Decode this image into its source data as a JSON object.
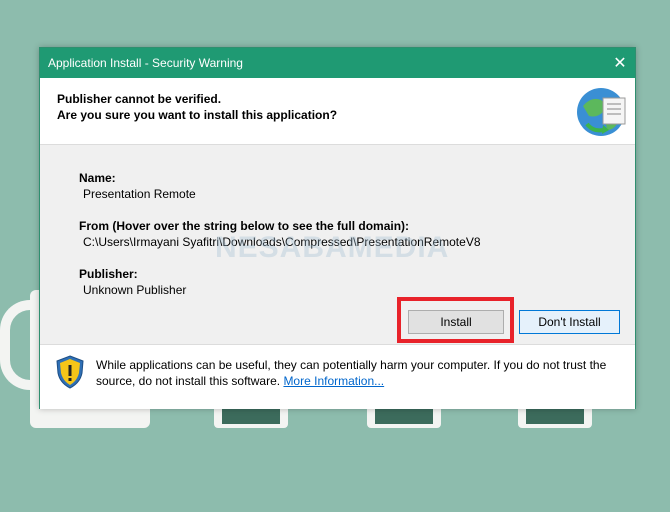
{
  "dialog": {
    "title": "Application Install - Security Warning",
    "close_glyph": "✕",
    "header_line1": "Publisher cannot be verified.",
    "header_line2": "Are you sure you want to install this application?",
    "name_label": "Name:",
    "name_value": "Presentation Remote",
    "from_label": "From (Hover over the string below to see the full domain):",
    "from_value": "C:\\Users\\Irmayani Syafitri\\Downloads\\Compressed\\PresentationRemoteV8",
    "publisher_label": "Publisher:",
    "publisher_value": "Unknown Publisher",
    "install_label": "Install",
    "dont_install_label": "Don't Install",
    "footer_text": "While applications can be useful, they can potentially harm your computer. If you do not trust the source, do not install this software.",
    "more_info_link": "More Information..."
  },
  "watermark": "NESABAMEDIA",
  "colors": {
    "titlebar": "#1f9a73",
    "highlight": "#e8222a",
    "background": "#8dbcad",
    "link": "#0066cc"
  },
  "icons": {
    "header_icon": "globe-install-icon",
    "footer_icon": "warning-shield-icon",
    "close_icon": "close-icon"
  }
}
